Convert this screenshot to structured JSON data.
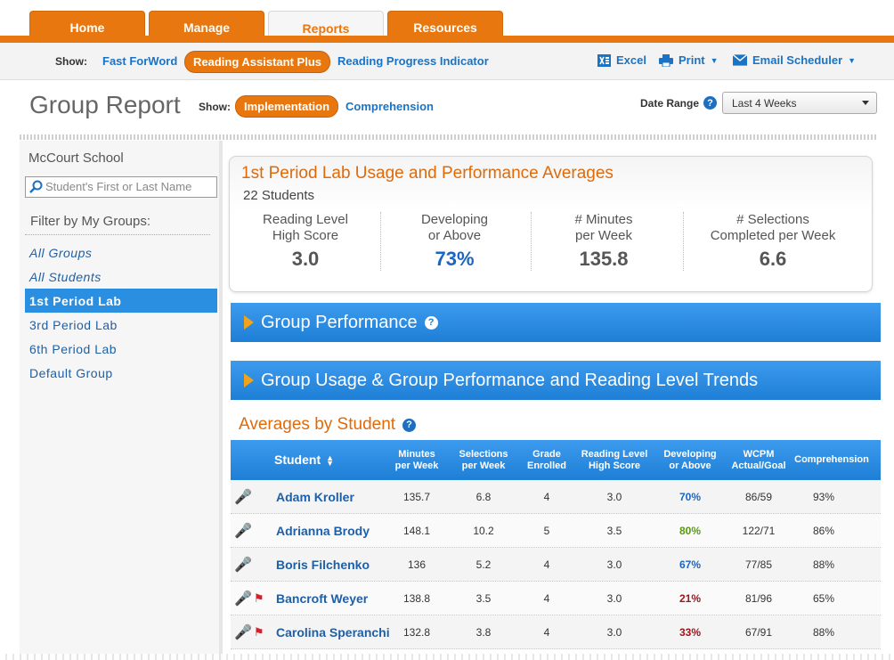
{
  "nav": {
    "tabs": [
      {
        "label": "Home"
      },
      {
        "label": "Manage"
      },
      {
        "label": "Reports"
      },
      {
        "label": "Resources"
      }
    ],
    "active_tab": "Reports"
  },
  "subnav": {
    "show_label": "Show:",
    "products": [
      "Fast ForWord",
      "Reading Assistant Plus",
      "Reading Progress Indicator"
    ],
    "active_product": "Reading Assistant Plus",
    "tools": {
      "excel": "Excel",
      "print": "Print",
      "email": "Email Scheduler"
    }
  },
  "header": {
    "title": "Group Report",
    "show_label": "Show:",
    "views": [
      "Implementation",
      "Comprehension"
    ],
    "active_view": "Implementation",
    "date_range_label": "Date Range",
    "date_range_value": "Last 4 Weeks"
  },
  "sidebar": {
    "school": "McCourt School",
    "search_placeholder": "Student's First or Last Name",
    "filter_heading": "Filter by My Groups:",
    "groups": [
      "All Groups",
      "All Students",
      "1st Period Lab",
      "3rd Period Lab",
      "6th Period Lab",
      "Default Group"
    ],
    "active_group": "1st Period Lab"
  },
  "summary": {
    "title": "1st Period Lab Usage and Performance Averages",
    "students": "22 Students",
    "stats": [
      {
        "label1": "Reading Level",
        "label2": "High Score",
        "value": "3.0"
      },
      {
        "label1": "Developing",
        "label2": "or Above",
        "value": "73%"
      },
      {
        "label1": "# Minutes",
        "label2": "per Week",
        "value": "135.8"
      },
      {
        "label1": "# Selections",
        "label2": "Completed per Week",
        "value": "6.6"
      }
    ]
  },
  "sections": {
    "group_performance": "Group Performance",
    "trends": "Group Usage & Group Performance and Reading Level Trends",
    "averages_title": "Averages by Student"
  },
  "table": {
    "headers": {
      "student": "Student",
      "minutes1": "Minutes",
      "minutes2": "per Week",
      "sel1": "Selections",
      "sel2": "per Week",
      "grade1": "Grade",
      "grade2": "Enrolled",
      "rl1": "Reading Level",
      "rl2": "High Score",
      "dev1": "Developing",
      "dev2": "or Above",
      "wcpm1": "WCPM",
      "wcpm2": "Actual/Goal",
      "comp": "Comprehension"
    },
    "rows": [
      {
        "name": "Adam Kroller",
        "minutes": "135.7",
        "selections": "6.8",
        "grade": "4",
        "reading_level": "3.0",
        "developing": "70%",
        "wcpm": "86/59",
        "comprehension": "93%"
      },
      {
        "name": "Adrianna Brody",
        "minutes": "148.1",
        "selections": "10.2",
        "grade": "5",
        "reading_level": "3.5",
        "developing": "80%",
        "wcpm": "122/71",
        "comprehension": "86%"
      },
      {
        "name": "Boris Filchenko",
        "minutes": "136",
        "selections": "5.2",
        "grade": "4",
        "reading_level": "3.0",
        "developing": "67%",
        "wcpm": "77/85",
        "comprehension": "88%"
      },
      {
        "name": "Bancroft Weyer",
        "minutes": "138.8",
        "selections": "3.5",
        "grade": "4",
        "reading_level": "3.0",
        "developing": "21%",
        "wcpm": "81/96",
        "comprehension": "65%"
      },
      {
        "name": "Carolina Speranchi",
        "minutes": "132.8",
        "selections": "3.8",
        "grade": "4",
        "reading_level": "3.0",
        "developing": "33%",
        "wcpm": "67/91",
        "comprehension": "88%"
      }
    ]
  },
  "colors": {
    "accent_orange": "#e8770f",
    "header_blue": "#1e7fd6",
    "link_blue": "#1a73c4",
    "dev_green": "#5a9a13",
    "dev_red": "#a0141c"
  }
}
